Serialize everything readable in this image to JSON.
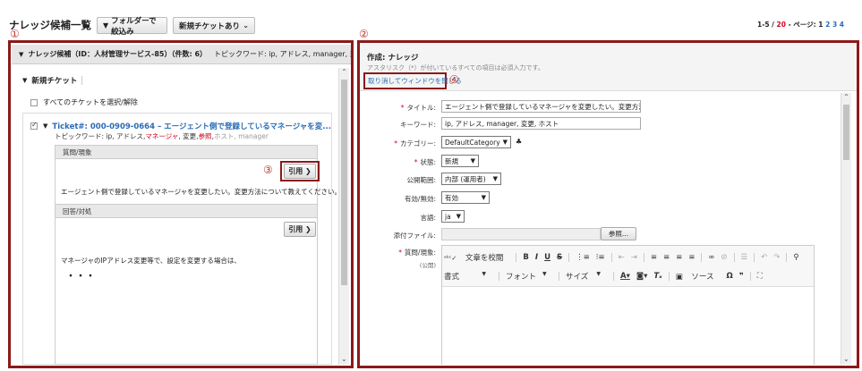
{
  "header": {
    "title": "ナレッジ候補一覧",
    "filter_folder": "フォルダーで絞込み",
    "filter_new": "新規チケットあり",
    "pagination": {
      "range": "1-5 / ",
      "total": "20",
      "sep": " - ページ: ",
      "p1": "1",
      "p2": "2",
      "p3": "3",
      "p4": "4"
    }
  },
  "badges": {
    "b1": "①",
    "b2": "②",
    "b3": "③",
    "b4": "④"
  },
  "left": {
    "header_title": "ナレッジ候補（ID：人材管理サービス-85）（件数: 6）",
    "header_keywords": "トピックワード: ip, アドレス, manager, 変...",
    "new_tickets": "新規チケット",
    "select_all": "すべてのチケットを選択/解除",
    "ticket": {
      "title": "Ticket#: 000-0909-0664 – エージェント側で登録しているマネージャを変...",
      "kw_prefix": "トピックワード: ip, アドレス, ",
      "kw_m": "マネージャ",
      "kw_mid": ", 変更, ",
      "kw_s": "参照",
      "kw_comma": ", ",
      "kw_h": "ホスト",
      "kw_end": ", manager"
    },
    "q_label": "質問/現象",
    "quote": "引用 ❯",
    "q_text": "エージェント側で登録しているマネージャを変更したい。変更方法について教えてください。",
    "a_label": "回答/対処",
    "a_text": "マネージャのIPアドレス変更等で、設定を変更する場合は、",
    "ellipsis": "・・・"
  },
  "right": {
    "title": "作成: ナレッジ",
    "note": "アスタリスク（*）が付いているすべての項目は必須入力です。",
    "close_link": "取り消してウィンドウを閉じる",
    "fields": {
      "title_label": "タイトル:",
      "title_value": "エージェント側で登録しているマネージャを変更したい。変更方法について",
      "keyword_label": "キーワード:",
      "keyword_value": "ip, アドレス, manager, 変更, ホスト",
      "category_label": "カテゴリー:",
      "category_value": "DefaultCategory",
      "state_label": "状態:",
      "state_value": "新規",
      "scope_label": "公開範囲:",
      "scope_value": "内部 (運用者)",
      "valid_label": "有効/無効:",
      "valid_value": "有効",
      "lang_label": "言語:",
      "lang_value": "ja",
      "attach_label": "添付ファイル:",
      "browse": "参照...",
      "qa_label": "質問/現象:",
      "qa_sub": "(公開)"
    },
    "toolbar": {
      "spell": "文章を校閲",
      "bold": "B",
      "italic": "I",
      "underline": "U",
      "strike": "S",
      "format": "書式",
      "font": "フォント",
      "size": "サイズ",
      "source": "ソース"
    }
  }
}
